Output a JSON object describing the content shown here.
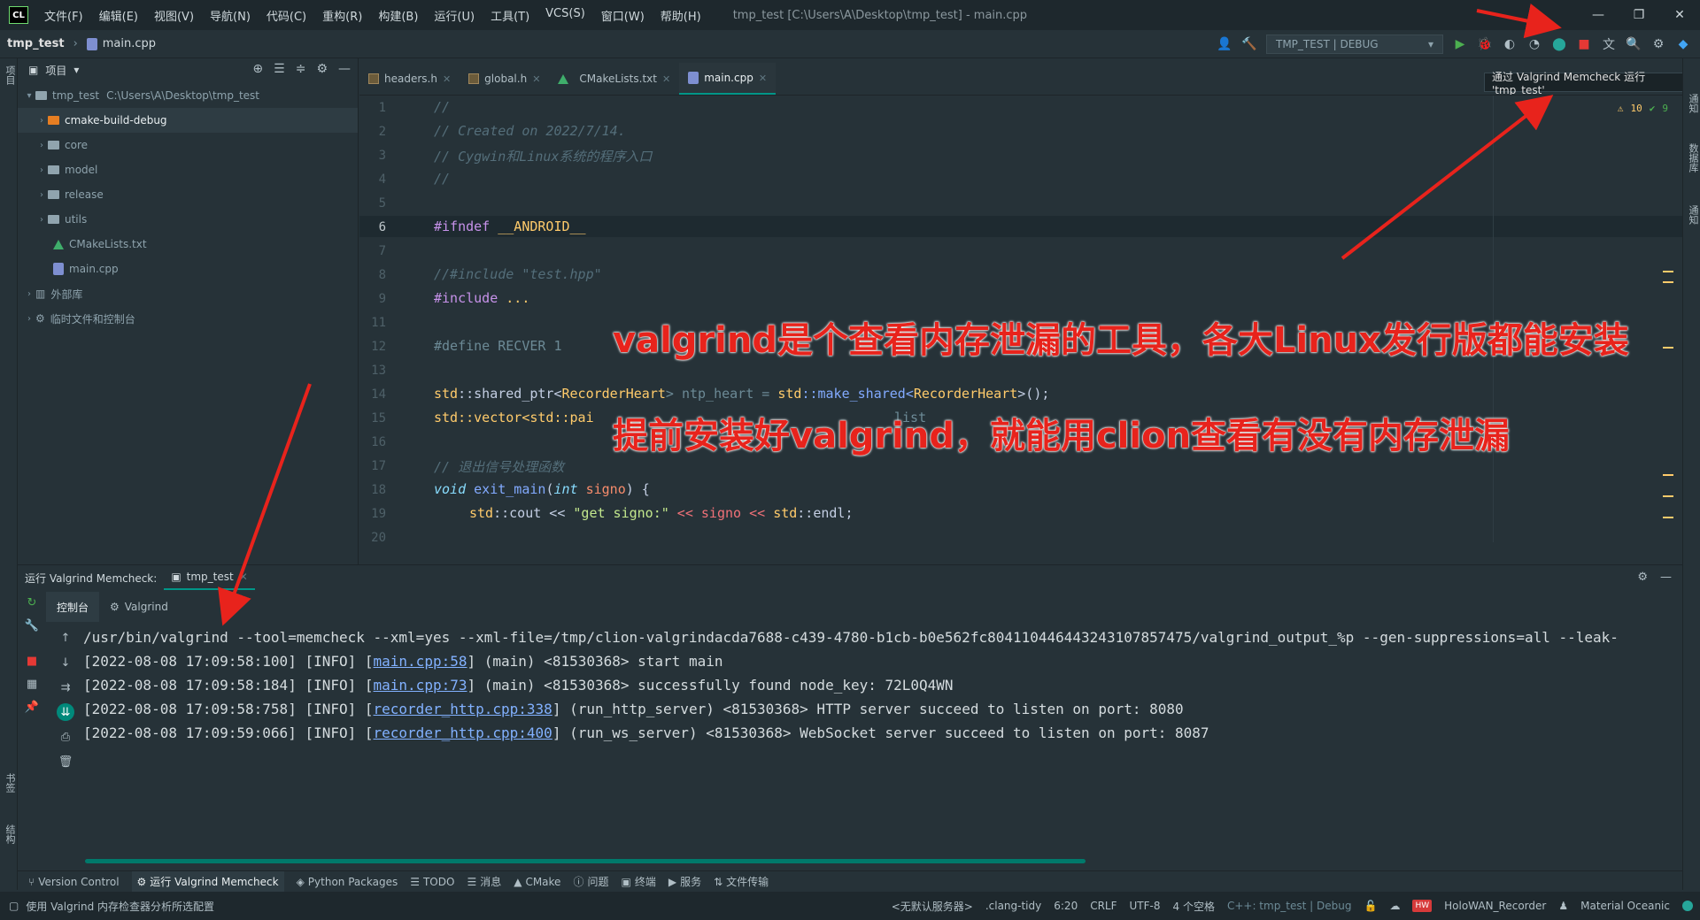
{
  "app": {
    "logo_text": "CL",
    "window_title": "tmp_test [C:\\Users\\A\\Desktop\\tmp_test] - main.cpp",
    "menu": [
      "文件(F)",
      "编辑(E)",
      "视图(V)",
      "导航(N)",
      "代码(C)",
      "重构(R)",
      "构建(B)",
      "运行(U)",
      "工具(T)",
      "VCS(S)",
      "窗口(W)",
      "帮助(H)"
    ]
  },
  "navbar": {
    "project": "tmp_test",
    "file": "main.cpp",
    "run_config": "TMP_TEST | DEBUG"
  },
  "tooltip": "通过 Valgrind Memcheck 运行 'tmp_test'",
  "project_panel": {
    "title": "项目",
    "root_name": "tmp_test",
    "root_path": "C:\\Users\\A\\Desktop\\tmp_test",
    "items": [
      {
        "label": "cmake-build-debug"
      },
      {
        "label": "core"
      },
      {
        "label": "model"
      },
      {
        "label": "release"
      },
      {
        "label": "utils"
      },
      {
        "label": "CMakeLists.txt"
      },
      {
        "label": "main.cpp"
      },
      {
        "label": "外部库"
      },
      {
        "label": "临时文件和控制台"
      }
    ]
  },
  "left_stripe": {
    "top": "项目",
    "mid": "书签",
    "bottom": "结构"
  },
  "right_stripe": {
    "a": "通知",
    "b": "数据库",
    "c": "通知"
  },
  "tabs": [
    "headers.h",
    "global.h",
    "CMakeLists.txt",
    "main.cpp"
  ],
  "inspections": {
    "warnings": "10",
    "ok": "9"
  },
  "editor_lines": [
    "1",
    "2",
    "3",
    "4",
    "5",
    "6",
    "7",
    "8",
    "9",
    "11",
    "12",
    "13",
    "14",
    "15",
    "16",
    "17",
    "18",
    "19",
    "20"
  ],
  "code": {
    "l1": "//",
    "l2": "// Created on 2022/7/14.",
    "l3": "// Cygwin和Linux系统的程序入口",
    "l4": "//",
    "l6_kw": "#ifndef",
    "l6_macro": "__ANDROID__",
    "l8": "//#include \"test.hpp\"",
    "l9_kw": "#include",
    "l9_rest": "...",
    "l12": "#define RECVER 1",
    "l14_a": "std",
    "l14_b": "::shared_ptr<",
    "l14_c": "RecorderHeart",
    "l14_d": "> ntp_heart = ",
    "l14_e": "std",
    "l14_f": "::make_shared<",
    "l14_g": "RecorderHeart",
    "l14_h": ">();",
    "l15": "std::vector<std::pai",
    "l15_tail": "list",
    "l17": "// 退出信号处理函数",
    "l18_a": "void",
    "l18_b": "exit_main",
    "l18_c": "(",
    "l18_d": "int",
    "l18_e": "signo",
    "l18_f": ") {",
    "l19_a": "std",
    "l19_b": "::cout << ",
    "l19_c": "\"get signo:\"",
    "l19_d": " << signo << ",
    "l19_e": "std",
    "l19_f": "::endl;"
  },
  "annotations": {
    "line1": "valgrind是个查看内存泄漏的工具，各大Linux发行版都能安装",
    "line2": "提前安装好valgrind，就能用clion查看有没有内存泄漏"
  },
  "run_panel": {
    "title": "运行 Valgrind Memcheck:",
    "tab": "tmp_test",
    "subtabs": [
      "控制台",
      "Valgrind"
    ],
    "console": {
      "cmd": "/usr/bin/valgrind --tool=memcheck --xml=yes --xml-file=/tmp/clion-valgrindacda7688-c439-4780-b1cb-b0e562fc8041104464432431078574​75/valgrind_output_%p --gen-suppressions=all --leak-",
      "lines": [
        {
          "pre": "[2022-08-08 17:09:58:100] [INFO] [",
          "link": "main.cpp:58",
          "post": "] (main) <81530368> start main"
        },
        {
          "pre": "[2022-08-08 17:09:58:184] [INFO] [",
          "link": "main.cpp:73",
          "post": "] (main) <81530368> successfully found node_key: 72L0Q4WN"
        },
        {
          "pre": "[2022-08-08 17:09:58:758] [INFO] [",
          "link": "recorder_http.cpp:338",
          "post": "] (run_http_server) <81530368> HTTP server succeed to listen on port: 8080"
        },
        {
          "pre": "[2022-08-08 17:09:59:066] [INFO] [",
          "link": "recorder_http.cpp:400",
          "post": "] (run_ws_server) <81530368> WebSocket server succeed to listen on port: 8087"
        }
      ]
    }
  },
  "toolwindows": [
    "Version Control",
    "运行 Valgrind Memcheck",
    "Python Packages",
    "TODO",
    "消息",
    "CMake",
    "问题",
    "终端",
    "服务",
    "文件传输"
  ],
  "status": {
    "message": "使用 Valgrind 内存检查器分析所选配置",
    "server": "<无默认服务器>",
    "linter": ".clang-tidy",
    "position": "6:20",
    "line_sep": "CRLF",
    "encoding": "UTF-8",
    "indent": "4 个空格",
    "context": "C++: tmp_test | Debug",
    "recorder": "HoloWAN_Recorder",
    "theme": "Material Oceanic",
    "hw_badge": "HW"
  },
  "colors": {
    "accent": "#009688",
    "annotation": "#e8231c",
    "background": "#263238"
  }
}
